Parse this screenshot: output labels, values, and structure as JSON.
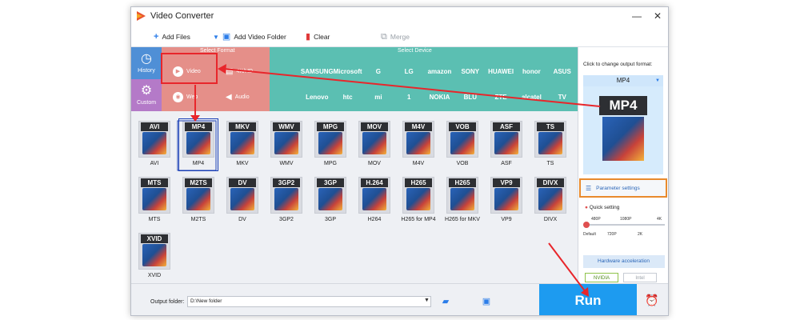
{
  "window": {
    "title": "Video Converter",
    "minimize": "—",
    "close": "✕"
  },
  "toolbar": {
    "add_files": "Add Files",
    "add_video_folder": "Add Video Folder",
    "clear": "Clear",
    "merge": "Merge"
  },
  "sidebar": {
    "history": "History",
    "custom": "Custom"
  },
  "format_band": {
    "title": "Select Format",
    "video": "Video",
    "fourk": "4K/HD",
    "web": "Web",
    "audio": "Audio"
  },
  "device_band": {
    "title": "Select Device",
    "row1": [
      "",
      "SAMSUNG",
      "Microsoft",
      "G",
      "LG",
      "amazon",
      "SONY",
      "HUAWEI",
      "honor",
      "ASUS"
    ],
    "row2": [
      "",
      "Lenovo",
      "htc",
      "mi",
      "1",
      "NOKIA",
      "BLU",
      "ZTE",
      "alcatel",
      "TV"
    ]
  },
  "formats": [
    {
      "tag": "AVI",
      "label": "AVI"
    },
    {
      "tag": "MP4",
      "label": "MP4"
    },
    {
      "tag": "MKV",
      "label": "MKV"
    },
    {
      "tag": "WMV",
      "label": "WMV"
    },
    {
      "tag": "MPG",
      "label": "MPG"
    },
    {
      "tag": "MOV",
      "label": "MOV"
    },
    {
      "tag": "M4V",
      "label": "M4V"
    },
    {
      "tag": "VOB",
      "label": "VOB"
    },
    {
      "tag": "ASF",
      "label": "ASF"
    },
    {
      "tag": "TS",
      "label": "TS"
    },
    {
      "tag": "MTS",
      "label": "MTS"
    },
    {
      "tag": "M2TS",
      "label": "M2TS"
    },
    {
      "tag": "DV",
      "label": "DV"
    },
    {
      "tag": "3GP2",
      "label": "3GP2"
    },
    {
      "tag": "3GP",
      "label": "3GP"
    },
    {
      "tag": "H.264",
      "label": "H264"
    },
    {
      "tag": "H265",
      "label": "H265 for MP4"
    },
    {
      "tag": "H265",
      "label": "H265 for MKV"
    },
    {
      "tag": "VP9",
      "label": "VP9"
    },
    {
      "tag": "DIVX",
      "label": "DIVX"
    },
    {
      "tag": "XVID",
      "label": "XVID"
    }
  ],
  "right_panel": {
    "hint": "Click to change output format:",
    "selected": "MP4",
    "preview_tag": "MP4",
    "parameter_settings": "Parameter settings",
    "quick_setting": "Quick setting",
    "ticks_top": [
      "480P",
      "1080P",
      "4K"
    ],
    "ticks_bottom": [
      "Default",
      "720P",
      "2K"
    ],
    "hardware_acceleration": "Hardware acceleration",
    "nvidia": "NVIDIA",
    "intel": "Intel"
  },
  "footer": {
    "output_label": "Output folder:",
    "output_value": "D:\\New folder",
    "run": "Run"
  },
  "colors": {
    "format_band": "#e58f89",
    "device_band": "#5bbfb2",
    "history": "#4f8fd6",
    "custom": "#b47ac8",
    "run": "#1d9bf0",
    "arrow": "#e8262b",
    "selection": "#1a3fb6",
    "highlight": "#e98a2c"
  }
}
